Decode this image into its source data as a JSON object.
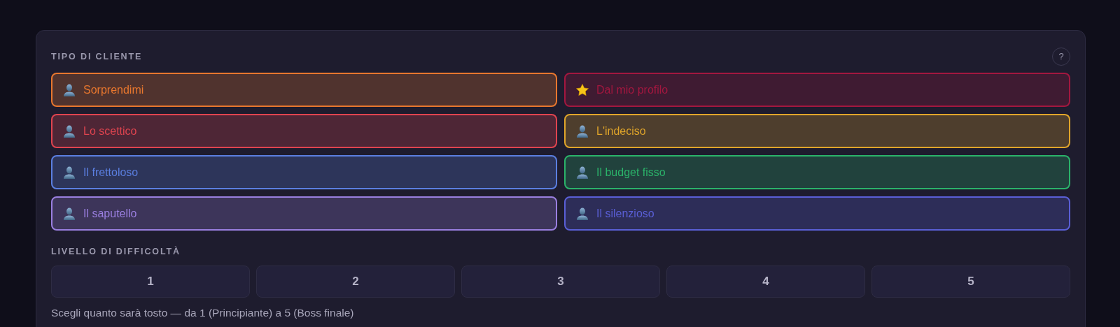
{
  "customer_type": {
    "title": "TIPO DI CLIENTE",
    "help": "?",
    "options": [
      {
        "label": "Sorprendimi",
        "kind": "person",
        "color": "#e8772e"
      },
      {
        "label": "Dal mio profilo",
        "kind": "star",
        "color": "#a3173f"
      },
      {
        "label": "Lo scettico",
        "kind": "person",
        "color": "#e0444f"
      },
      {
        "label": "L'indeciso",
        "kind": "person",
        "color": "#e0a52a"
      },
      {
        "label": "Il frettoloso",
        "kind": "person",
        "color": "#5b7fe0"
      },
      {
        "label": "Il budget fisso",
        "kind": "person",
        "color": "#2bb36a"
      },
      {
        "label": "Il saputello",
        "kind": "person",
        "color": "#9a7fe0"
      },
      {
        "label": "Il silenzioso",
        "kind": "person",
        "color": "#5a5fd6"
      }
    ]
  },
  "difficulty": {
    "title": "LIVELLO DI DIFFICOLTÀ",
    "levels": [
      "1",
      "2",
      "3",
      "4",
      "5"
    ],
    "hint": "Scegli quanto sarà tosto — da 1 (Principiante) a 5 (Boss finale)"
  }
}
